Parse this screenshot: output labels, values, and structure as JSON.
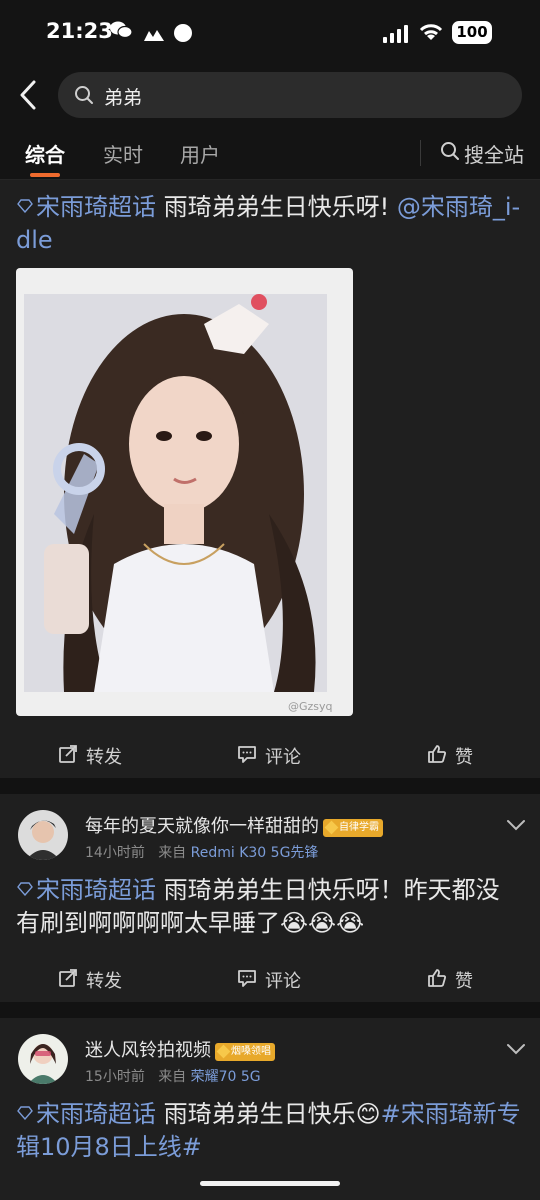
{
  "status_bar": {
    "time": "21:23",
    "battery": "100",
    "icons": [
      "wechat-icon",
      "app-icon",
      "dot-icon",
      "signal-icon",
      "wifi-icon",
      "battery-icon"
    ]
  },
  "search": {
    "query": "弟弟"
  },
  "tabs": [
    {
      "label": "综合",
      "active": true
    },
    {
      "label": "实时",
      "active": false
    },
    {
      "label": "用户",
      "active": false
    }
  ],
  "search_site_label": "搜全站",
  "posts": [
    {
      "topic": "宋雨琦超话",
      "text": " 雨琦弟弟生日快乐呀! ",
      "mention": "@宋雨琦_i-dle",
      "image_watermark": "@Gzsyq",
      "actions": {
        "repost": "转发",
        "comment": "评论",
        "like": "赞"
      }
    },
    {
      "username": "每年的夏天就像你一样甜甜的",
      "badge": "自律学霸",
      "badge_level": "2",
      "time": "14小时前",
      "source_prefix": "来自",
      "device": "Redmi K30 5G先锋",
      "topic": "宋雨琦超话",
      "text": " 雨琦弟弟生日快乐呀！昨天都没有刷到啊啊啊啊太早睡了😭😭😭",
      "actions": {
        "repost": "转发",
        "comment": "评论",
        "like": "赞"
      }
    },
    {
      "username": "迷人风铃拍视频",
      "badge": "烟嗓领唱",
      "badge_level": "5",
      "time": "15小时前",
      "source_prefix": "来自",
      "device": "荣耀70 5G",
      "topic": "宋雨琦超话",
      "text": " 雨琦弟弟生日快乐😊",
      "hashtag": "#宋雨琦新专辑10月8日上线#"
    }
  ],
  "colors": {
    "accent": "#f06b2e",
    "link": "#7b9cd8",
    "background": "#1f1f1f"
  }
}
